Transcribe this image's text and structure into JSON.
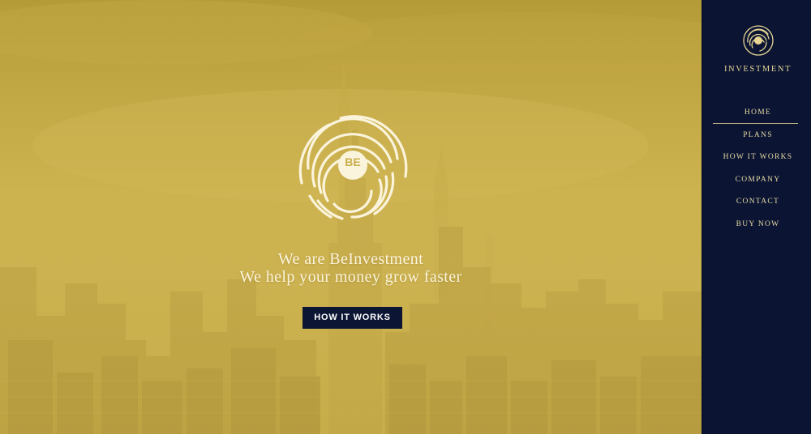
{
  "hero": {
    "line1": "We are BeInvestment",
    "line2": "We help your money grow faster",
    "button_label": "HOW IT WORKS",
    "logo_initials": "BE",
    "overlay_color": "#c9ae4c"
  },
  "sidebar": {
    "brand_name": "INVESTMENT",
    "brand_icon": "fingerprint-logo-icon",
    "nav": [
      {
        "label": "HOME",
        "active": true
      },
      {
        "label": "PLANS",
        "active": false
      },
      {
        "label": "HOW IT WORKS",
        "active": false
      },
      {
        "label": "COMPANY",
        "active": false
      },
      {
        "label": "CONTACT",
        "active": false
      },
      {
        "label": "BUY NOW",
        "active": false
      }
    ],
    "background_color": "#0b1533",
    "accent_color": "#e6d495"
  }
}
